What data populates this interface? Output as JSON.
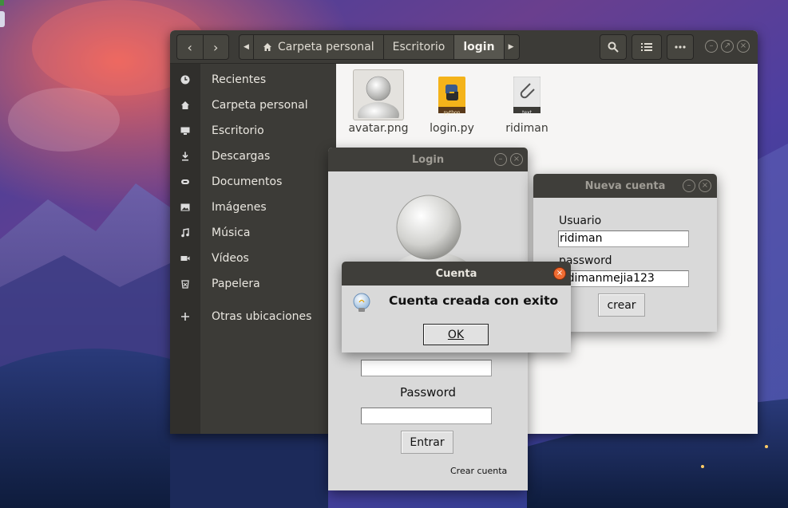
{
  "desktop": {},
  "files_window": {
    "nav": {
      "back_icon": "chevron-left-icon",
      "forward_icon": "chevron-right-icon"
    },
    "breadcrumbs": [
      "Carpeta personal",
      "Escritorio",
      "login"
    ],
    "tools": [
      "search-icon",
      "list-view-icon",
      "menu-icon"
    ],
    "sidebar": [
      {
        "label": "Recientes",
        "icon": "clock-icon"
      },
      {
        "label": "Carpeta personal",
        "icon": "home-icon"
      },
      {
        "label": "Escritorio",
        "icon": "desktop-icon"
      },
      {
        "label": "Descargas",
        "icon": "download-icon"
      },
      {
        "label": "Documentos",
        "icon": "document-icon"
      },
      {
        "label": "Imágenes",
        "icon": "image-icon"
      },
      {
        "label": "Música",
        "icon": "music-icon"
      },
      {
        "label": "Vídeos",
        "icon": "video-icon"
      },
      {
        "label": "Papelera",
        "icon": "trash-icon"
      },
      {
        "label": "Otras ubicaciones",
        "icon": "plus-icon"
      }
    ],
    "files": [
      {
        "name": "avatar.png",
        "icon": "avatar-image-icon"
      },
      {
        "name": "login.py",
        "icon": "python-file-icon",
        "badge": "python"
      },
      {
        "name": "ridiman",
        "icon": "text-file-icon",
        "badge": "text"
      }
    ]
  },
  "login_window": {
    "title": "Login",
    "password_label": "Password",
    "username_value": "",
    "password_value": "",
    "enter_button": "Entrar",
    "create_account_link": "Crear cuenta"
  },
  "new_account_window": {
    "title": "Nueva cuenta",
    "user_label": "Usuario",
    "user_value": "ridiman",
    "password_label": "password",
    "password_value": "ridimanmejia123",
    "create_button": "crear"
  },
  "message_dialog": {
    "title": "Cuenta",
    "message": "Cuenta creada con exito",
    "ok_button": "OK",
    "icon": "info-lightbulb-icon"
  },
  "colors": {
    "titlebar": "#3f3e3a",
    "sidebar": "#3c3b37",
    "tk_bg": "#d9d9d9",
    "close_accent": "#f06c32"
  }
}
